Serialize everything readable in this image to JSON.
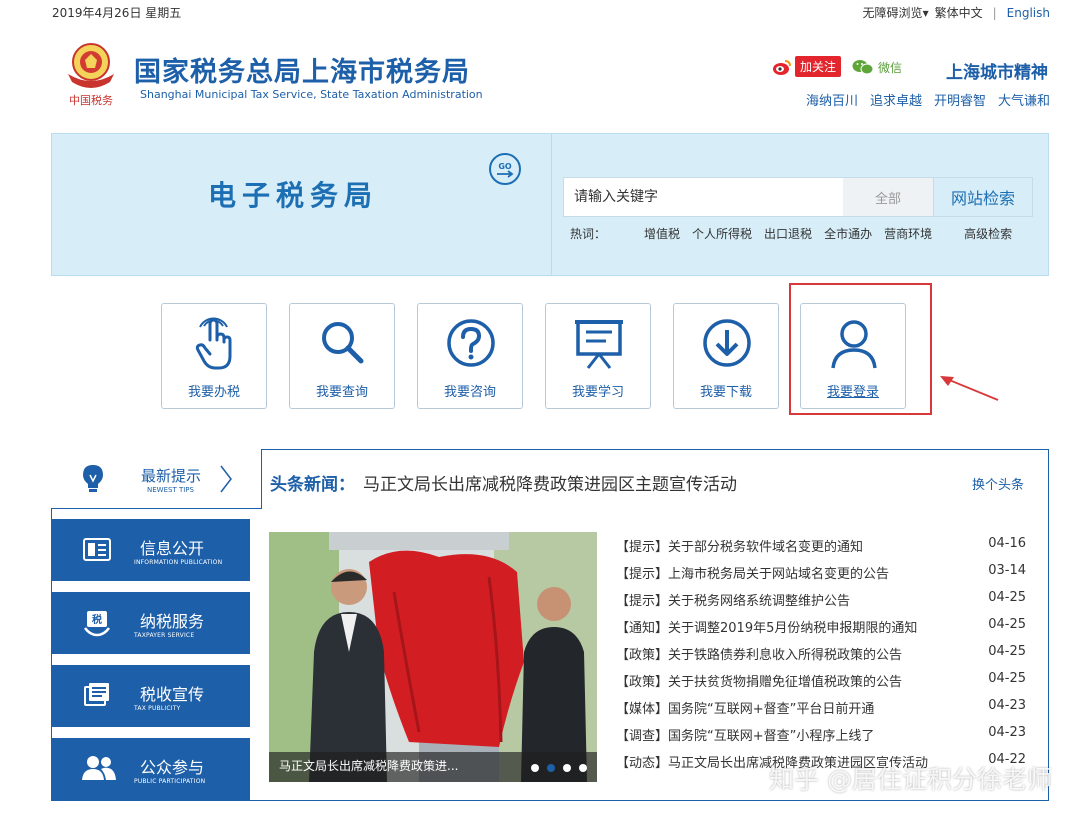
{
  "topbar": {
    "date": "2019年4月26日 星期五",
    "accessibility": "无障碍浏览",
    "traditional": "繁体中文",
    "english": "English"
  },
  "header": {
    "logo_text": "中国税务",
    "title": "国家税务总局上海市税务局",
    "subtitle": "Shanghai Municipal Tax Service, State Taxation Administration",
    "weibo_label": "加关注",
    "wechat_label": "微信",
    "spirit_title": "上海城市精神",
    "spirit_items": [
      "海纳百川",
      "追求卓越",
      "开明睿智",
      "大气谦和"
    ]
  },
  "banner": {
    "title": "电子税务局",
    "search_placeholder": "请输入关键字",
    "scope": "全部",
    "search_button": "网站检索",
    "hot_label": "热词：",
    "hot_words": [
      "增值税",
      "个人所得税",
      "出口退税",
      "全市通办",
      "营商环境"
    ],
    "advanced": "高级检索"
  },
  "quick_links": [
    {
      "label": "我要办税",
      "icon": "hand-touch-icon"
    },
    {
      "label": "我要查询",
      "icon": "search-icon"
    },
    {
      "label": "我要咨询",
      "icon": "question-icon"
    },
    {
      "label": "我要学习",
      "icon": "presentation-icon"
    },
    {
      "label": "我要下载",
      "icon": "download-icon"
    },
    {
      "label": "我要登录",
      "icon": "user-icon"
    }
  ],
  "tips": {
    "title": "最新提示",
    "subtitle": "NEWEST TIPS"
  },
  "headline": {
    "label": "头条新闻：",
    "text": "马正文局长出席减税降费政策进园区主题宣传活动",
    "switch": "换个头条"
  },
  "categories": [
    {
      "name": "信息公开",
      "en": "INFORMATION PUBLICATION",
      "icon": "document-icon"
    },
    {
      "name": "纳税服务",
      "en": "TAXPAYER SERVICE",
      "icon": "tax-hand-icon"
    },
    {
      "name": "税收宣传",
      "en": "TAX PUBLICITY",
      "icon": "publicity-icon"
    },
    {
      "name": "公众参与",
      "en": "PUBLIC PARTICIPATION",
      "icon": "people-icon"
    }
  ],
  "slide": {
    "caption": "马正文局长出席减税降费政策进...",
    "dots": 4,
    "active_dot": 1
  },
  "news": [
    {
      "tag": "【提示】",
      "title": "关于部分税务软件域名变更的通知",
      "date": "04-16"
    },
    {
      "tag": "【提示】",
      "title": "上海市税务局关于网站域名变更的公告",
      "date": "03-14"
    },
    {
      "tag": "【提示】",
      "title": "关于税务网络系统调整维护公告",
      "date": "04-25"
    },
    {
      "tag": "【通知】",
      "title": "关于调整2019年5月份纳税申报期限的通知",
      "date": "04-25"
    },
    {
      "tag": "【政策】",
      "title": "关于铁路债券利息收入所得税政策的公告",
      "date": "04-25"
    },
    {
      "tag": "【政策】",
      "title": "关于扶贫货物捐赠免征增值税政策的公告",
      "date": "04-25"
    },
    {
      "tag": "【媒体】",
      "title": "国务院“互联网+督查”平台日前开通",
      "date": "04-23"
    },
    {
      "tag": "【调查】",
      "title": "国务院“互联网+督查”小程序上线了",
      "date": "04-23"
    },
    {
      "tag": "【动态】",
      "title": "马正文局长出席减税降费政策进园区宣传活动",
      "date": "04-22"
    }
  ],
  "watermark": "知乎 @居住证积分徐老师",
  "colors": {
    "brand_blue": "#1d5fa8",
    "banner_bg": "#d7eef9",
    "highlight_red": "#d9383a"
  }
}
